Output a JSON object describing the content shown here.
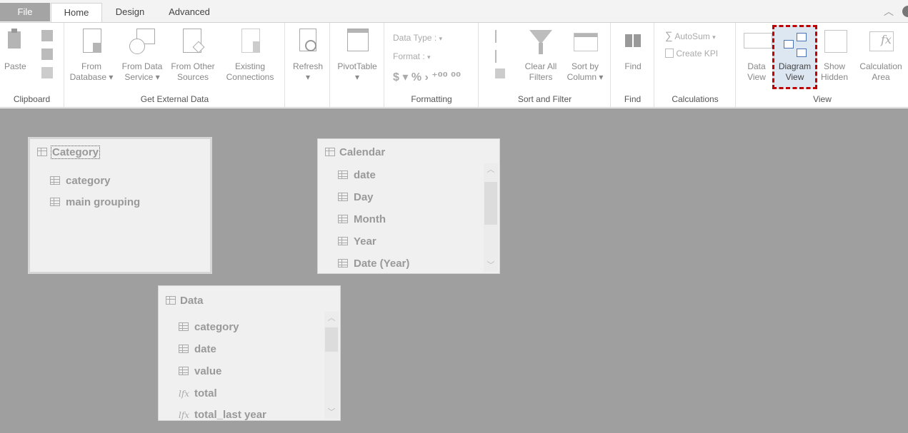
{
  "tabs": {
    "file": "File",
    "home": "Home",
    "design": "Design",
    "advanced": "Advanced"
  },
  "ribbon": {
    "clipboard": {
      "label": "Clipboard",
      "paste": "Paste"
    },
    "get_external_data": {
      "label": "Get External Data",
      "from_database": [
        "From",
        "Database ▾"
      ],
      "from_data_service": [
        "From Data",
        "Service ▾"
      ],
      "from_other_sources": [
        "From Other",
        "Sources"
      ],
      "existing_connections": [
        "Existing",
        "Connections"
      ]
    },
    "refresh": {
      "label": "Refresh",
      "arrow": "▾"
    },
    "pivottable": {
      "label": "PivotTable",
      "arrow": "▾"
    },
    "formatting": {
      "label": "Formatting",
      "data_type": "Data Type :",
      "format": "Format :",
      "symbols": "$ ▾ %  ›  ⁺⁰⁰  ⁰⁰"
    },
    "sort_filter": {
      "label": "Sort and Filter",
      "clear_all_filters": [
        "Clear All",
        "Filters"
      ],
      "sort_by_column": [
        "Sort by",
        "Column ▾"
      ]
    },
    "find": {
      "group_label": "Find",
      "button": "Find"
    },
    "calculations": {
      "label": "Calculations",
      "autosum": "AutoSum",
      "create_kpi": "Create KPI"
    },
    "view": {
      "label": "View",
      "data_view": [
        "Data",
        "View"
      ],
      "diagram_view": [
        "Diagram",
        "View"
      ],
      "show_hidden": [
        "Show",
        "Hidden"
      ],
      "calculation_area": [
        "Calculation",
        "Area"
      ]
    }
  },
  "tables": {
    "category": {
      "title": "Category",
      "fields": [
        "category",
        "main grouping"
      ]
    },
    "calendar": {
      "title": "Calendar",
      "fields": [
        "date",
        "Day",
        "Month",
        "Year",
        "Date (Year)"
      ]
    },
    "data": {
      "title": "Data",
      "fields": [
        "category",
        "date",
        "value"
      ],
      "measures": [
        "total",
        "total_last year"
      ]
    }
  },
  "icons": {
    "table": "table-icon",
    "column": "column-icon",
    "measure": "fx-icon"
  },
  "colors": {
    "highlight": "#c00000",
    "canvas": "#9f9f9f"
  }
}
